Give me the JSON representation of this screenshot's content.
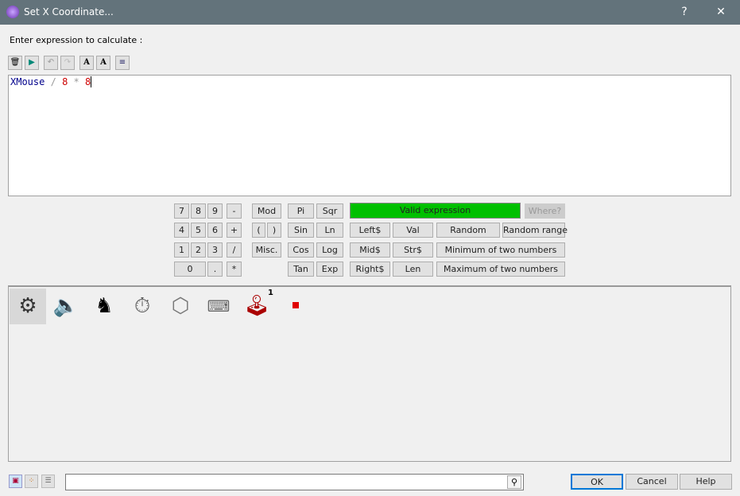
{
  "window": {
    "title": "Set X Coordinate...",
    "help": "?",
    "close": "✕"
  },
  "prompt": "Enter expression to calculate :",
  "toolbar": [
    "trash-icon",
    "run-icon",
    "undo-icon",
    "redo-icon",
    "font-larger-icon",
    "font-smaller-icon",
    "wrap-icon"
  ],
  "expression": {
    "token1": "XMouse",
    "op1": "/",
    "num1": "8",
    "op2": "*",
    "num2": "8"
  },
  "keypad": {
    "k7": "7",
    "k8": "8",
    "k9": "9",
    "minus": "-",
    "k4": "4",
    "k5": "5",
    "k6": "6",
    "plus": "+",
    "k1": "1",
    "k2": "2",
    "k3": "3",
    "div": "/",
    "k0": "0",
    "dot": ".",
    "mul": "*",
    "mod": "Mod",
    "lparen": "(",
    "rparen": ")",
    "misc": "Misc."
  },
  "functions": {
    "pi": "Pi",
    "sqr": "Sqr",
    "sin": "Sin",
    "ln": "Ln",
    "cos": "Cos",
    "log": "Log",
    "tan": "Tan",
    "exp": "Exp",
    "left": "Left$",
    "val": "Val",
    "random": "Random",
    "random_range": "Random range",
    "mid": "Mid$",
    "str": "Str$",
    "min": "Minimum of two numbers",
    "right": "Right$",
    "len": "Len",
    "max": "Maximum of two numbers"
  },
  "status": {
    "text": "Valid expression",
    "color": "#00c000"
  },
  "where": "Where?",
  "objects": [
    {
      "icon": "gears-icon",
      "selected": true
    },
    {
      "icon": "speaker-icon"
    },
    {
      "icon": "chess-icon"
    },
    {
      "icon": "timer-icon"
    },
    {
      "icon": "create-object-icon"
    },
    {
      "icon": "keyboard-mouse-icon"
    },
    {
      "icon": "joystick-icon",
      "badge": "1"
    },
    {
      "icon": "red-square-icon"
    }
  ],
  "bottom": {
    "search_value": "",
    "ok": "OK",
    "cancel": "Cancel",
    "help": "Help"
  }
}
